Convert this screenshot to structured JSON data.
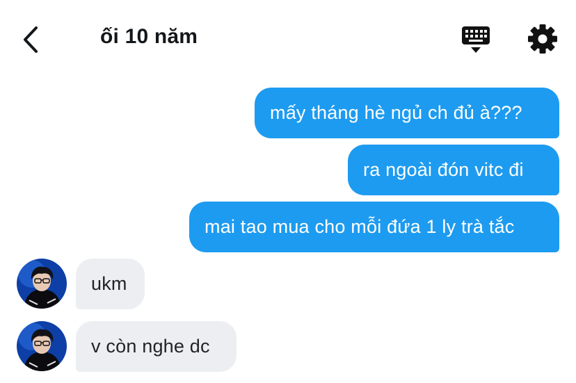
{
  "header": {
    "title": "ối 10 năm",
    "back_icon": "chevron-left-icon",
    "keyboard_icon": "keyboard-icon",
    "settings_icon": "gear-icon"
  },
  "colors": {
    "outgoing_bubble": "#1d9bf0",
    "incoming_bubble": "#eceef1",
    "outgoing_text": "#ffffff",
    "incoming_text": "#1f2328"
  },
  "messages": [
    {
      "direction": "outgoing",
      "text": "mấy tháng hè ngủ ch đủ à???"
    },
    {
      "direction": "outgoing",
      "text": "ra ngoài đón vitc đi"
    },
    {
      "direction": "outgoing",
      "text": "mai tao mua cho mỗi đứa 1 ly trà tắc"
    },
    {
      "direction": "incoming",
      "text": "ukm"
    },
    {
      "direction": "incoming",
      "text": "v còn nghe dc"
    }
  ]
}
